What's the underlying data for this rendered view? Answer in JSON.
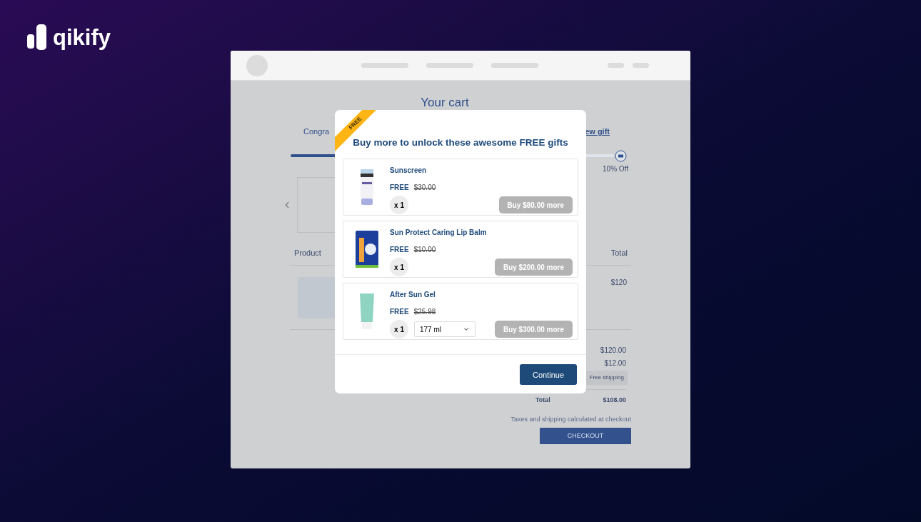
{
  "brand": {
    "name": "qikify"
  },
  "cart": {
    "title": "Your cart",
    "message": "Congra",
    "link": "ew gift",
    "progress": {
      "level": 0.3
    },
    "milestone": "10% Off",
    "columns": [
      "Product",
      "Total"
    ],
    "row": {
      "total": "$120"
    },
    "summary": [
      {
        "kind": "amount",
        "value": "$120.00"
      },
      {
        "kind": "amount",
        "value": "$12.00"
      },
      {
        "kind": "tag",
        "value": "Free shipping"
      },
      {
        "kind": "total",
        "label": "Total",
        "value": "$108.00"
      }
    ],
    "note": "Taxes and shipping calculated at checkout",
    "checkout": "CHECKOUT"
  },
  "modal": {
    "ribbon": "FREE",
    "title": "Buy more to unlock these awesome FREE gifts",
    "gifts": [
      {
        "kind": "tube",
        "name": "Sunscreen",
        "price": "FREE",
        "original": "$30.00",
        "qty": "x 1",
        "button": "Buy $80.00 more"
      },
      {
        "kind": "balm",
        "name": "Sun Protect Caring Lip Balm",
        "price": "FREE",
        "original": "$10.00",
        "qty": "x 1",
        "button": "Buy $200.00 more"
      },
      {
        "kind": "gel",
        "name": "After Sun Gel",
        "price": "FREE",
        "original": "$25.98",
        "qty": "x 1",
        "variant": "177 ml",
        "button": "Buy $300.00 more"
      }
    ],
    "continue": "Continue"
  }
}
